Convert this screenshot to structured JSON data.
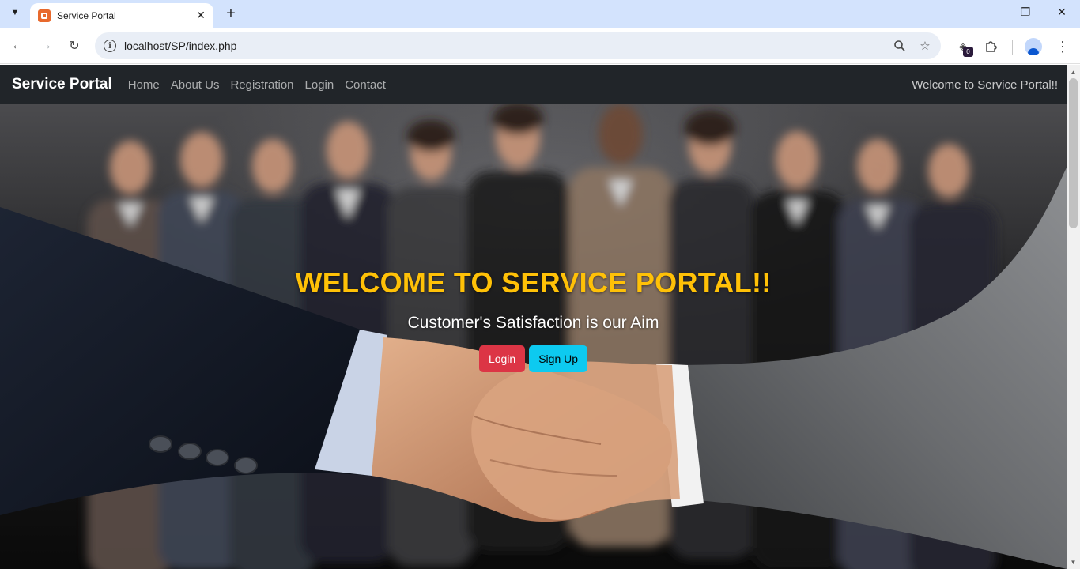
{
  "browser": {
    "tab_title": "Service Portal",
    "url": "localhost/SP/index.php",
    "extension_badge": "0",
    "icons": [
      "tab-search-icon",
      "favicon-icon",
      "close-icon",
      "plus-icon",
      "minimize-icon",
      "restore-icon",
      "window-close-icon",
      "back-icon",
      "forward-icon",
      "reload-icon",
      "info-icon",
      "zoom-icon",
      "star-icon",
      "extension-icon",
      "puzzle-icon",
      "profile-icon",
      "menu-icon"
    ]
  },
  "navbar": {
    "brand": "Service Portal",
    "links": [
      "Home",
      "About Us",
      "Registration",
      "Login",
      "Contact"
    ],
    "right_text": "Welcome to Service Portal!!"
  },
  "hero": {
    "title": "WELCOME TO SERVICE PORTAL!!",
    "subtitle": "Customer's Satisfaction is our Aim",
    "login_label": "Login",
    "signup_label": "Sign Up"
  },
  "colors": {
    "navbar_bg": "#212529",
    "title": "#ffc107",
    "login_btn": "#dc3545",
    "signup_btn": "#0dcaf0"
  }
}
